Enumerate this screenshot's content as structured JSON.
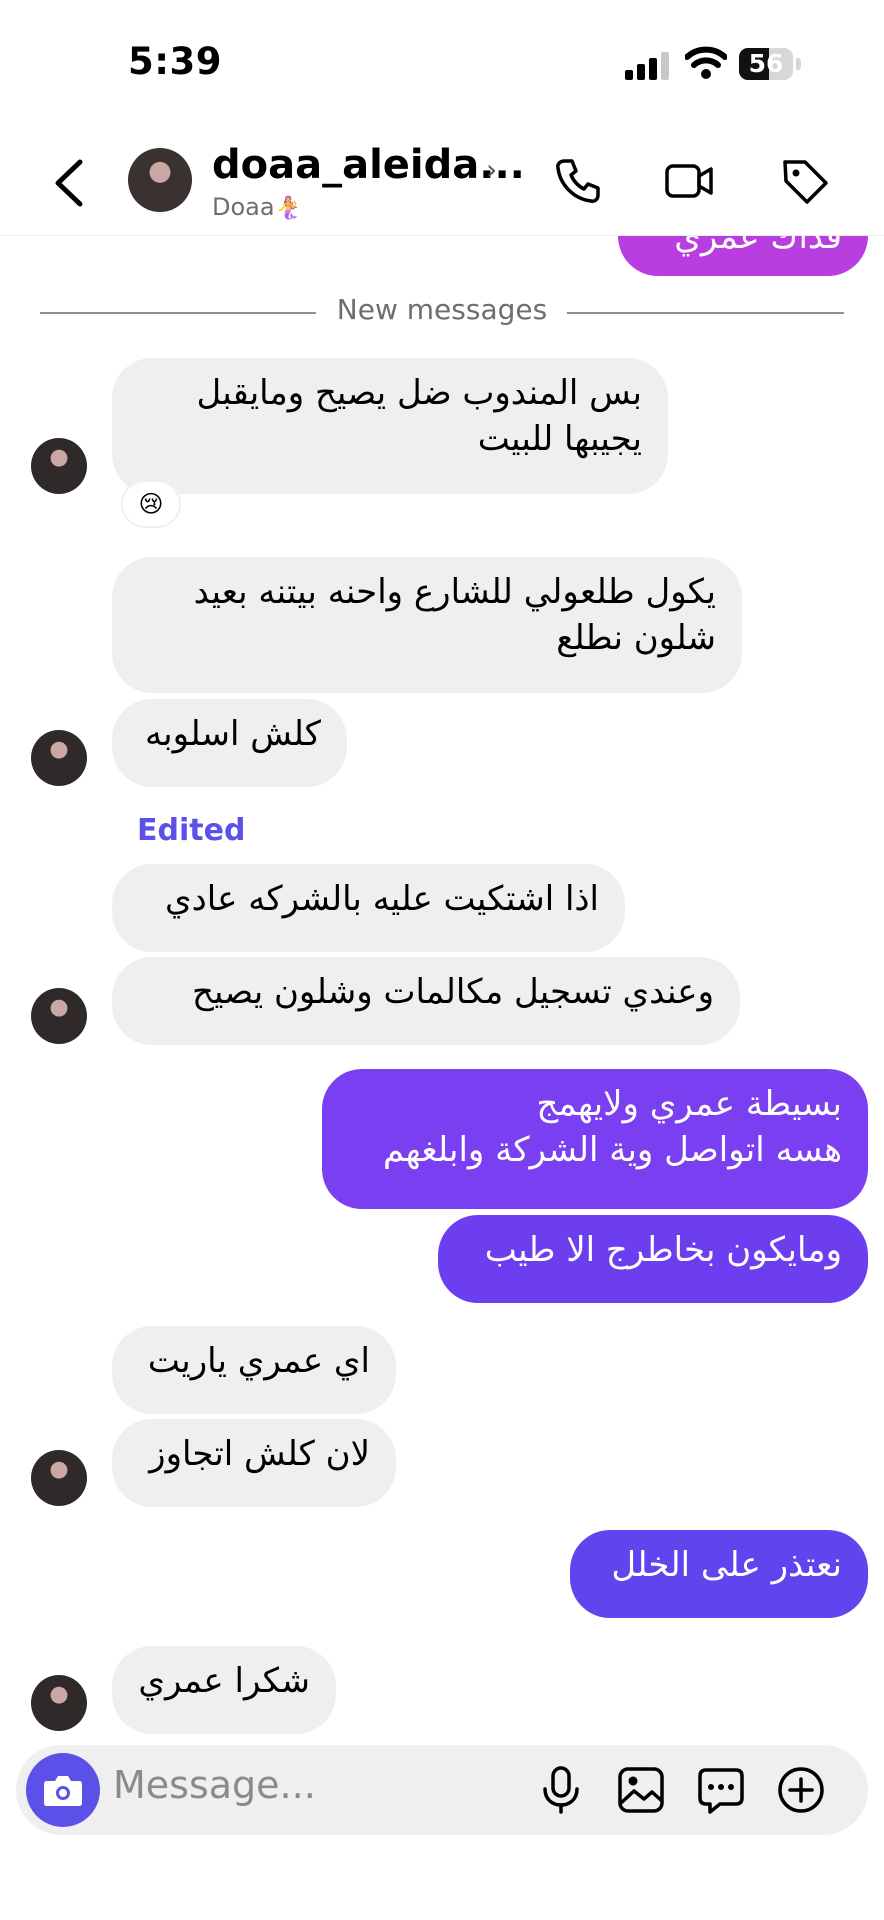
{
  "status": {
    "time": "5:39",
    "battery": "56",
    "battery_level": 0.56
  },
  "header": {
    "username": "doaa_aleida...",
    "subname": "Doaa",
    "subname_emoji": "🧜‍♀️",
    "chevron": "›"
  },
  "chat": {
    "partial_outgoing": "فدّاك عمري",
    "new_messages_label": "New messages",
    "edited_label": "Edited",
    "reaction_emoji": "😢",
    "messages": [
      {
        "side": "in",
        "text_line1": "بس المندوب ضل يصيح ومايقبل",
        "text_line2": "يجيبها للبيت"
      },
      {
        "side": "in",
        "text_line1": "يكول طلعولي للشارع واحنه بيتنه بعيد",
        "text_line2": "شلون نطلع"
      },
      {
        "side": "in",
        "text": "كلش اسلوبه"
      },
      {
        "side": "in",
        "text": "اذا اشتكيت عليه بالشركه عادي"
      },
      {
        "side": "in",
        "text": "وعندي تسجيل مكالمات وشلون يصيح"
      },
      {
        "side": "out",
        "text_line1": "بسيطة عمري ولايهمج",
        "text_line2": "هسه اتواصل وية الشركة وابلغهم"
      },
      {
        "side": "out",
        "text": "ومايكون بخاطرج الا طيب"
      },
      {
        "side": "in",
        "text": "اي عمري ياريت"
      },
      {
        "side": "in",
        "text": "لان كلش اتجاوز"
      },
      {
        "side": "out",
        "text": "نعتذر على الخلل"
      },
      {
        "side": "in",
        "text": "شكرا عمري"
      }
    ]
  },
  "composer": {
    "placeholder": "Message..."
  },
  "icons": {
    "back": "chevron-left-icon",
    "call": "phone-icon",
    "video": "video-camera-icon",
    "tag": "tag-icon",
    "camera": "camera-icon",
    "mic": "microphone-icon",
    "gallery": "image-icon",
    "sticker": "chat-sticker-icon",
    "add": "plus-circle-icon"
  },
  "colors": {
    "incoming_bubble": "#efefef",
    "outgoing_top": "#7b3ff2",
    "outgoing_mid": "#6d3ef0",
    "outgoing_bottom": "#5f45ee",
    "partial_bubble": "#b83ee0",
    "accent": "#5b51e8"
  }
}
